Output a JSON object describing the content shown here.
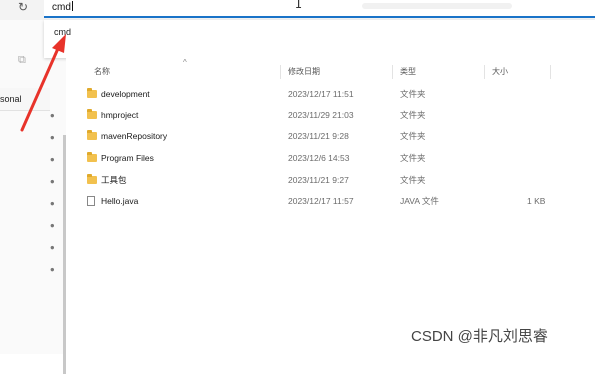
{
  "address_bar": {
    "value": "cmd"
  },
  "suggestion": {
    "text": "cmd"
  },
  "sidebar": {
    "label": "sonal"
  },
  "columns": {
    "name": "名称",
    "modified": "修改日期",
    "type": "类型",
    "size": "大小"
  },
  "files": [
    {
      "name": "development",
      "date": "2023/12/17 11:51",
      "type": "文件夹",
      "size": "",
      "kind": "folder"
    },
    {
      "name": "hmproject",
      "date": "2023/11/29 21:03",
      "type": "文件夹",
      "size": "",
      "kind": "folder"
    },
    {
      "name": "mavenRepository",
      "date": "2023/11/21 9:28",
      "type": "文件夹",
      "size": "",
      "kind": "folder"
    },
    {
      "name": "Program Files",
      "date": "2023/12/6 14:53",
      "type": "文件夹",
      "size": "",
      "kind": "folder"
    },
    {
      "name": "工具包",
      "date": "2023/11/21 9:27",
      "type": "文件夹",
      "size": "",
      "kind": "folder"
    },
    {
      "name": "Hello.java",
      "date": "2023/12/17 11:57",
      "type": "JAVA 文件",
      "size": "1 KB",
      "kind": "file"
    }
  ],
  "watermark": "CSDN @非凡刘思睿",
  "colors": {
    "accent": "#1a73c8",
    "annotation_arrow": "#e8332a",
    "folder": "#f2c14e"
  },
  "icons": {
    "refresh": "refresh-icon",
    "copy": "copy-icon",
    "pin": "pin-icon",
    "folder": "folder-icon",
    "file": "file-icon"
  }
}
